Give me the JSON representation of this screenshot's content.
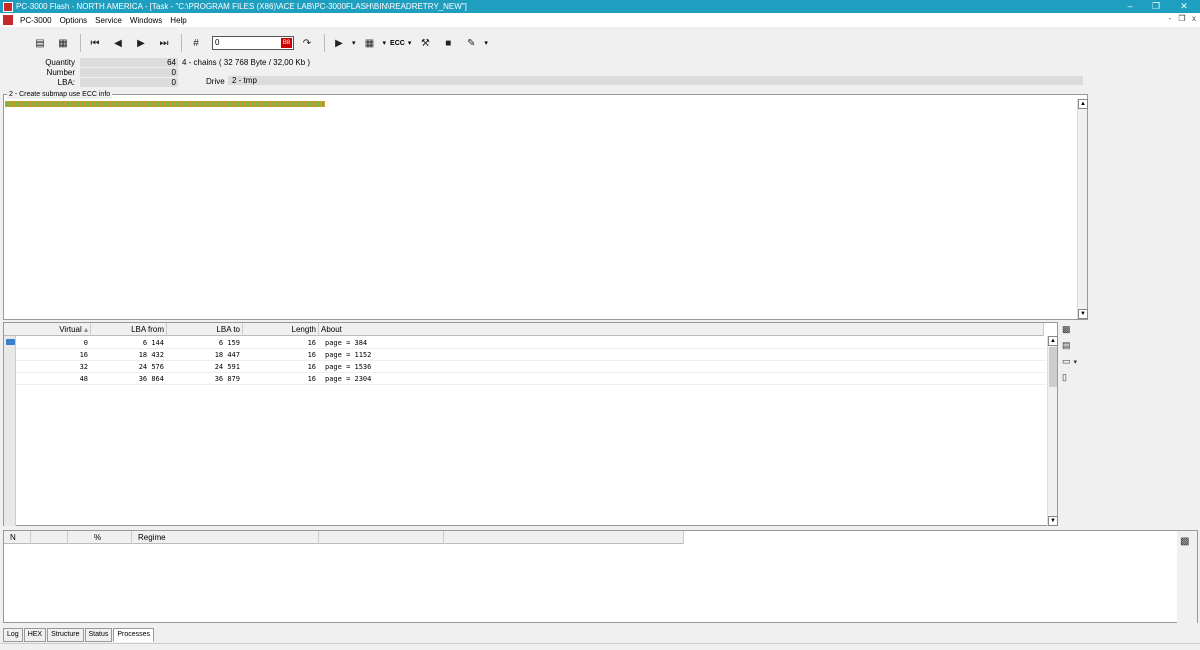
{
  "window": {
    "title": "PC-3000 Flash - NORTH AMERICA - [Task - \"C:\\PROGRAM FILES (X86)\\ACE LAB\\PC-3000FLASH\\BIN\\READRETRY_NEW\"]",
    "minimize": "–",
    "maximize": "❐",
    "close": "✕"
  },
  "menu": {
    "items": [
      "PC-3000",
      "Options",
      "Service",
      "Windows",
      "Help"
    ],
    "mdi_min": "-",
    "mdi_restore": "❐",
    "mdi_close": "x"
  },
  "toolbar": {
    "goto_value": "0",
    "goto_button": "B8",
    "ecc_label": "ECC",
    "dropdown_glyph": "▾"
  },
  "info": {
    "quantity_label": "Quantity",
    "quantity_value": "64",
    "quantity_detail": "4 - chains  (  32 768 Byte /  32,00 Kb )",
    "number_label": "Number",
    "number_value": "0",
    "lba_label": "LBA:",
    "lba_value": "0",
    "drive_label": "Drive",
    "drive_value": "2 - tmp"
  },
  "submap": {
    "legend": "2 - Create submap use ECC info",
    "block_count": 64,
    "colors": {
      "block_fill": "#7cb342",
      "block_border": "#c99a2e"
    }
  },
  "grid": {
    "headers": {
      "virtual": "Virtual",
      "lba_from": "LBA from",
      "lba_to": "LBA to",
      "length": "Length",
      "about": "About"
    },
    "sort_glyph": "▴",
    "rows": [
      {
        "virtual": "0",
        "lba_from": "6 144",
        "lba_to": "6 159",
        "length": "16",
        "about": "page = 384"
      },
      {
        "virtual": "16",
        "lba_from": "18 432",
        "lba_to": "18 447",
        "length": "16",
        "about": "page = 1152"
      },
      {
        "virtual": "32",
        "lba_from": "24 576",
        "lba_to": "24 591",
        "length": "16",
        "about": "page = 1536"
      },
      {
        "virtual": "48",
        "lba_from": "36 864",
        "lba_to": "36 879",
        "length": "16",
        "about": "page = 2304"
      }
    ]
  },
  "processes": {
    "headers": {
      "n": "N",
      "blank": "",
      "percent": "%",
      "regime": "Regime",
      "col5": "",
      "col6": ""
    }
  },
  "tabs": [
    "Log",
    "HEX",
    "Structure",
    "Status",
    "Processes"
  ],
  "active_tab": "Processes",
  "colors": {
    "titlebar": "#1f9fbf",
    "pointer": "#3a7fd0"
  }
}
